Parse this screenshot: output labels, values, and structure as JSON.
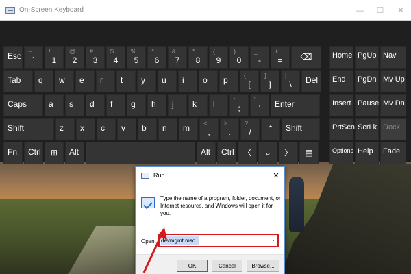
{
  "osk": {
    "title": "On-Screen Keyboard",
    "window_buttons": {
      "minimize": "—",
      "maximize": "☐",
      "close": "✕"
    },
    "rows": [
      [
        {
          "id": "esc",
          "label": "Esc"
        },
        {
          "id": "backtick",
          "sub": "~",
          "main": "`"
        },
        {
          "id": "1",
          "sub": "!",
          "main": "1"
        },
        {
          "id": "2",
          "sub": "@",
          "main": "2"
        },
        {
          "id": "3",
          "sub": "#",
          "main": "3"
        },
        {
          "id": "4",
          "sub": "$",
          "main": "4"
        },
        {
          "id": "5",
          "sub": "%",
          "main": "5"
        },
        {
          "id": "6",
          "sub": "^",
          "main": "6"
        },
        {
          "id": "7",
          "sub": "&",
          "main": "7"
        },
        {
          "id": "8",
          "sub": "*",
          "main": "8"
        },
        {
          "id": "9",
          "sub": "(",
          "main": "9"
        },
        {
          "id": "0",
          "sub": ")",
          "main": "0"
        },
        {
          "id": "minus",
          "sub": "_",
          "main": "-"
        },
        {
          "id": "equals",
          "sub": "+",
          "main": "="
        },
        {
          "id": "backspace",
          "label": "⌫"
        }
      ],
      [
        {
          "id": "tab",
          "label": "Tab"
        },
        {
          "id": "q",
          "label": "q"
        },
        {
          "id": "w",
          "label": "w"
        },
        {
          "id": "e",
          "label": "e"
        },
        {
          "id": "r",
          "label": "r"
        },
        {
          "id": "t",
          "label": "t"
        },
        {
          "id": "y",
          "label": "y"
        },
        {
          "id": "u",
          "label": "u"
        },
        {
          "id": "i",
          "label": "i"
        },
        {
          "id": "o",
          "label": "o"
        },
        {
          "id": "p",
          "label": "p"
        },
        {
          "id": "lbracket",
          "sub": "{",
          "main": "["
        },
        {
          "id": "rbracket",
          "sub": "}",
          "main": "]"
        },
        {
          "id": "backslash",
          "sub": "|",
          "main": "\\"
        },
        {
          "id": "del",
          "label": "Del"
        }
      ],
      [
        {
          "id": "caps",
          "label": "Caps"
        },
        {
          "id": "a",
          "label": "a"
        },
        {
          "id": "s",
          "label": "s"
        },
        {
          "id": "d",
          "label": "d"
        },
        {
          "id": "f",
          "label": "f"
        },
        {
          "id": "g",
          "label": "g"
        },
        {
          "id": "h",
          "label": "h"
        },
        {
          "id": "j",
          "label": "j"
        },
        {
          "id": "k",
          "label": "k"
        },
        {
          "id": "l",
          "label": "l"
        },
        {
          "id": "semicolon",
          "sub": ":",
          "main": ";"
        },
        {
          "id": "quote",
          "sub": "\"",
          "main": "'"
        },
        {
          "id": "enter",
          "label": "Enter"
        }
      ],
      [
        {
          "id": "lshift",
          "label": "Shift"
        },
        {
          "id": "z",
          "label": "z"
        },
        {
          "id": "x",
          "label": "x"
        },
        {
          "id": "c",
          "label": "c"
        },
        {
          "id": "v",
          "label": "v"
        },
        {
          "id": "b",
          "label": "b"
        },
        {
          "id": "n",
          "label": "n"
        },
        {
          "id": "m",
          "label": "m"
        },
        {
          "id": "comma",
          "sub": "<",
          "main": ","
        },
        {
          "id": "period",
          "sub": ">",
          "main": "."
        },
        {
          "id": "slash",
          "sub": "?",
          "main": "/"
        },
        {
          "id": "up",
          "label": "⌃"
        },
        {
          "id": "rshift",
          "label": "Shift"
        }
      ],
      [
        {
          "id": "fn",
          "label": "Fn"
        },
        {
          "id": "lctrl",
          "label": "Ctrl"
        },
        {
          "id": "win",
          "label": "⊞"
        },
        {
          "id": "lalt",
          "label": "Alt"
        },
        {
          "id": "space",
          "label": ""
        },
        {
          "id": "ralt",
          "label": "Alt"
        },
        {
          "id": "rctrl",
          "label": "Ctrl"
        },
        {
          "id": "left",
          "label": "〈"
        },
        {
          "id": "down",
          "label": "⌄"
        },
        {
          "id": "right",
          "label": "〉"
        },
        {
          "id": "menu",
          "label": "▤"
        }
      ]
    ],
    "nav_keys": [
      [
        {
          "id": "home",
          "label": "Home"
        },
        {
          "id": "pgup",
          "label": "PgUp"
        },
        {
          "id": "nav",
          "label": "Nav"
        }
      ],
      [
        {
          "id": "end",
          "label": "End"
        },
        {
          "id": "pgdn",
          "label": "PgDn"
        },
        {
          "id": "mvup",
          "label": "Mv Up"
        }
      ],
      [
        {
          "id": "insert",
          "label": "Insert"
        },
        {
          "id": "pause",
          "label": "Pause"
        },
        {
          "id": "mvdn",
          "label": "Mv Dn"
        }
      ],
      [
        {
          "id": "prtscn",
          "label": "PrtScn"
        },
        {
          "id": "scrlk",
          "label": "ScrLk"
        },
        {
          "id": "dock",
          "label": "Dock"
        }
      ],
      [
        {
          "id": "options",
          "label": "Options"
        },
        {
          "id": "help",
          "label": "Help"
        },
        {
          "id": "fade",
          "label": "Fade"
        }
      ]
    ]
  },
  "run": {
    "title": "Run",
    "close": "✕",
    "description": "Type the name of a program, folder, document, or Internet resource, and Windows will open it for you.",
    "open_label": "Open:",
    "input_value": "devmgmt.msc",
    "dropdown": "⌄",
    "buttons": {
      "ok": "OK",
      "cancel": "Cancel",
      "browse": "Browse..."
    }
  },
  "colors": {
    "osk_bg": "#1f1f1f",
    "key_bg": "#343434",
    "highlight_red": "#d41a1a",
    "accent": "#0078d7"
  }
}
